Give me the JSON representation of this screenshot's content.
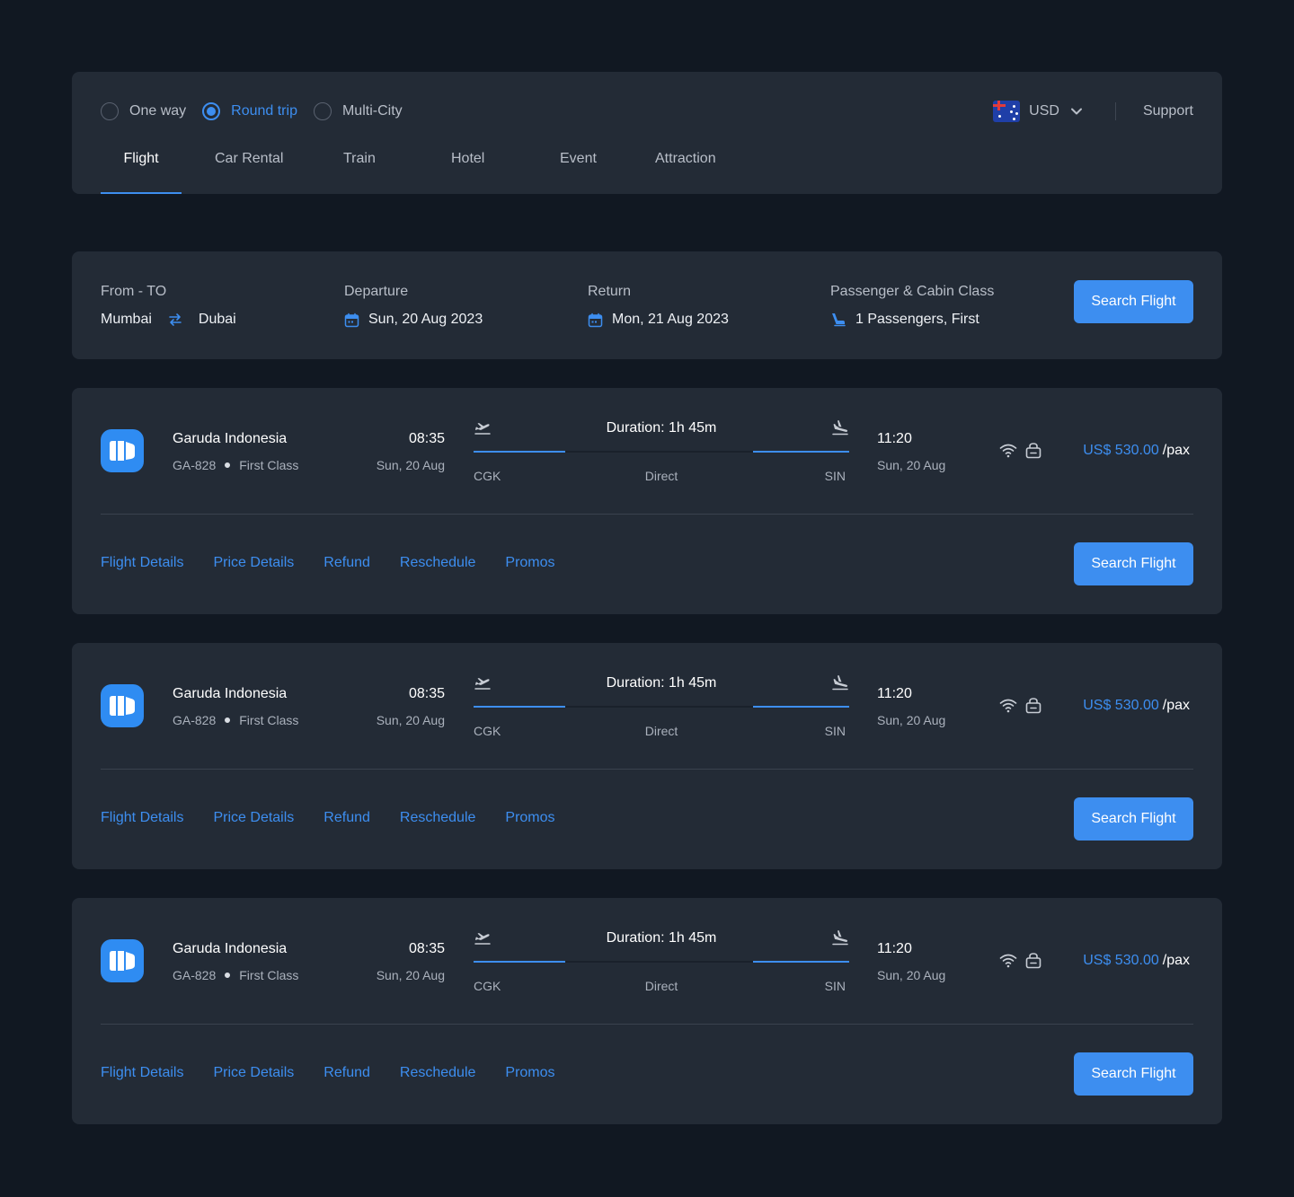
{
  "trip_types": [
    {
      "label": "One way",
      "selected": false
    },
    {
      "label": "Round trip",
      "selected": true
    },
    {
      "label": "Multi-City",
      "selected": false
    }
  ],
  "currency": {
    "code": "USD",
    "flag_icon": "australia-flag-icon"
  },
  "support_label": "Support",
  "tabs": [
    {
      "label": "Flight",
      "active": true
    },
    {
      "label": "Car Rental",
      "active": false
    },
    {
      "label": "Train",
      "active": false
    },
    {
      "label": "Hotel",
      "active": false
    },
    {
      "label": "Event",
      "active": false
    },
    {
      "label": "Attraction",
      "active": false
    }
  ],
  "search": {
    "route_label": "From - TO",
    "origin": "Mumbai",
    "destination": "Dubai",
    "departure_label": "Departure",
    "departure_value": "Sun, 20 Aug 2023",
    "return_label": "Return",
    "return_value": "Mon, 21 Aug 2023",
    "passenger_label": "Passenger & Cabin Class",
    "passenger_value": "1 Passengers, First",
    "button_label": "Search Flight"
  },
  "results": [
    {
      "airline": "Garuda Indonesia",
      "flight_no": "GA-828",
      "cabin": "First Class",
      "dep_time": "08:35",
      "dep_date": "Sun, 20 Aug",
      "duration": "Duration: 1h 45m",
      "origin_code": "CGK",
      "stops": "Direct",
      "dest_code": "SIN",
      "arr_time": "11:20",
      "arr_date": "Sun, 20 Aug",
      "price": "US$ 530.00",
      "price_unit": "/pax",
      "links": [
        "Flight Details",
        "Price Details",
        "Refund",
        "Reschedule",
        "Promos"
      ],
      "button_label": "Search Flight"
    },
    {
      "airline": "Garuda Indonesia",
      "flight_no": "GA-828",
      "cabin": "First Class",
      "dep_time": "08:35",
      "dep_date": "Sun, 20 Aug",
      "duration": "Duration: 1h 45m",
      "origin_code": "CGK",
      "stops": "Direct",
      "dest_code": "SIN",
      "arr_time": "11:20",
      "arr_date": "Sun, 20 Aug",
      "price": "US$ 530.00",
      "price_unit": "/pax",
      "links": [
        "Flight Details",
        "Price Details",
        "Refund",
        "Reschedule",
        "Promos"
      ],
      "button_label": "Search Flight"
    },
    {
      "airline": "Garuda Indonesia",
      "flight_no": "GA-828",
      "cabin": "First Class",
      "dep_time": "08:35",
      "dep_date": "Sun, 20 Aug",
      "duration": "Duration: 1h 45m",
      "origin_code": "CGK",
      "stops": "Direct",
      "dest_code": "SIN",
      "arr_time": "11:20",
      "arr_date": "Sun, 20 Aug",
      "price": "US$ 530.00",
      "price_unit": "/pax",
      "links": [
        "Flight Details",
        "Price Details",
        "Refund",
        "Reschedule",
        "Promos"
      ],
      "button_label": "Search Flight"
    }
  ],
  "colors": {
    "background": "#111822",
    "panel": "#232b36",
    "accent": "#3d8ef0",
    "muted_text": "#b8bec8"
  }
}
